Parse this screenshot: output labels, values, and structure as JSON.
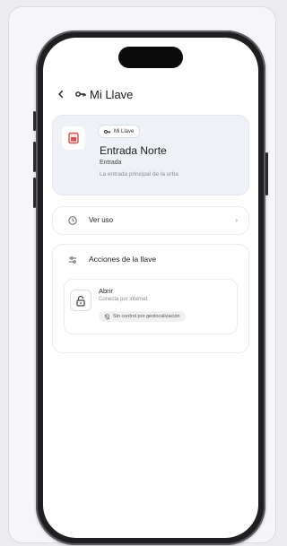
{
  "header": {
    "title": "Mi Llave"
  },
  "key_card": {
    "chip_label": "Mi Llave",
    "name": "Entrada Norte",
    "type": "Entrada",
    "description": "La entrada principal de la urba"
  },
  "history": {
    "label": "Ver uso"
  },
  "actions": {
    "title": "Acciones de la llave",
    "open": {
      "label": "Abrir",
      "subtitle": "Conecta por internet",
      "geo_chip": "Sin control por geolocalización"
    }
  },
  "colors": {
    "accent": "#d9534f",
    "card_bg": "#eef2f7"
  }
}
